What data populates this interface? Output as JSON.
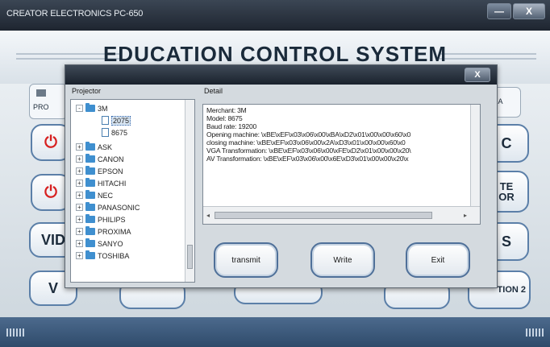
{
  "window": {
    "title": "CREATOR ELECTRONICS PC-650",
    "heading": "EDUCATION CONTROL SYSTEM",
    "minimize_glyph": "—",
    "close_glyph": "X"
  },
  "background": {
    "tab_left": "PRO",
    "tab_right": "IA",
    "btn_right1": "C",
    "btn_right2_l1": "TE",
    "btn_right2_l2": "OR",
    "btn_left3": "VID",
    "btn_right3": "S",
    "btn_left4": "V",
    "btn_right4": "TION 2"
  },
  "dialog": {
    "close_glyph": "X",
    "projector_label": "Projector",
    "detail_label": "Detail",
    "tree": [
      {
        "label": "3M",
        "expander": "-"
      },
      {
        "label": "2075"
      },
      {
        "label": "8675"
      },
      {
        "label": "ASK",
        "expander": "+"
      },
      {
        "label": "CANON",
        "expander": "+"
      },
      {
        "label": "EPSON",
        "expander": "+"
      },
      {
        "label": "HITACHI",
        "expander": "+"
      },
      {
        "label": "NEC",
        "expander": "+"
      },
      {
        "label": "PANASONIC",
        "expander": "+"
      },
      {
        "label": "PHILIPS",
        "expander": "+"
      },
      {
        "label": "PROXIMA",
        "expander": "+"
      },
      {
        "label": "SANYO",
        "expander": "+"
      },
      {
        "label": "TOSHIBA",
        "expander": "+"
      }
    ],
    "detail_lines": [
      "Merchant: 3M",
      "Model: 8675",
      "Baud rate: 19200",
      "Opening machine: \\xBE\\xEF\\x03\\x06\\x00\\xBA\\xD2\\x01\\x00\\x00\\x60\\x0",
      "closing machine: \\xBE\\xEF\\x03\\x06\\x00\\x2A\\xD3\\x01\\x00\\x00\\x60\\x0",
      "VGA Transformation: \\xBE\\xEF\\x03\\x06\\x00\\xFE\\xD2\\x01\\x00\\x00\\x20\\",
      "AV Transformation: \\xBE\\xEF\\x03\\x06\\x00\\x6E\\xD3\\x01\\x00\\x00\\x20\\x"
    ],
    "buttons": {
      "transmit": "transmit",
      "write": "Write",
      "exit": "Exit"
    }
  }
}
